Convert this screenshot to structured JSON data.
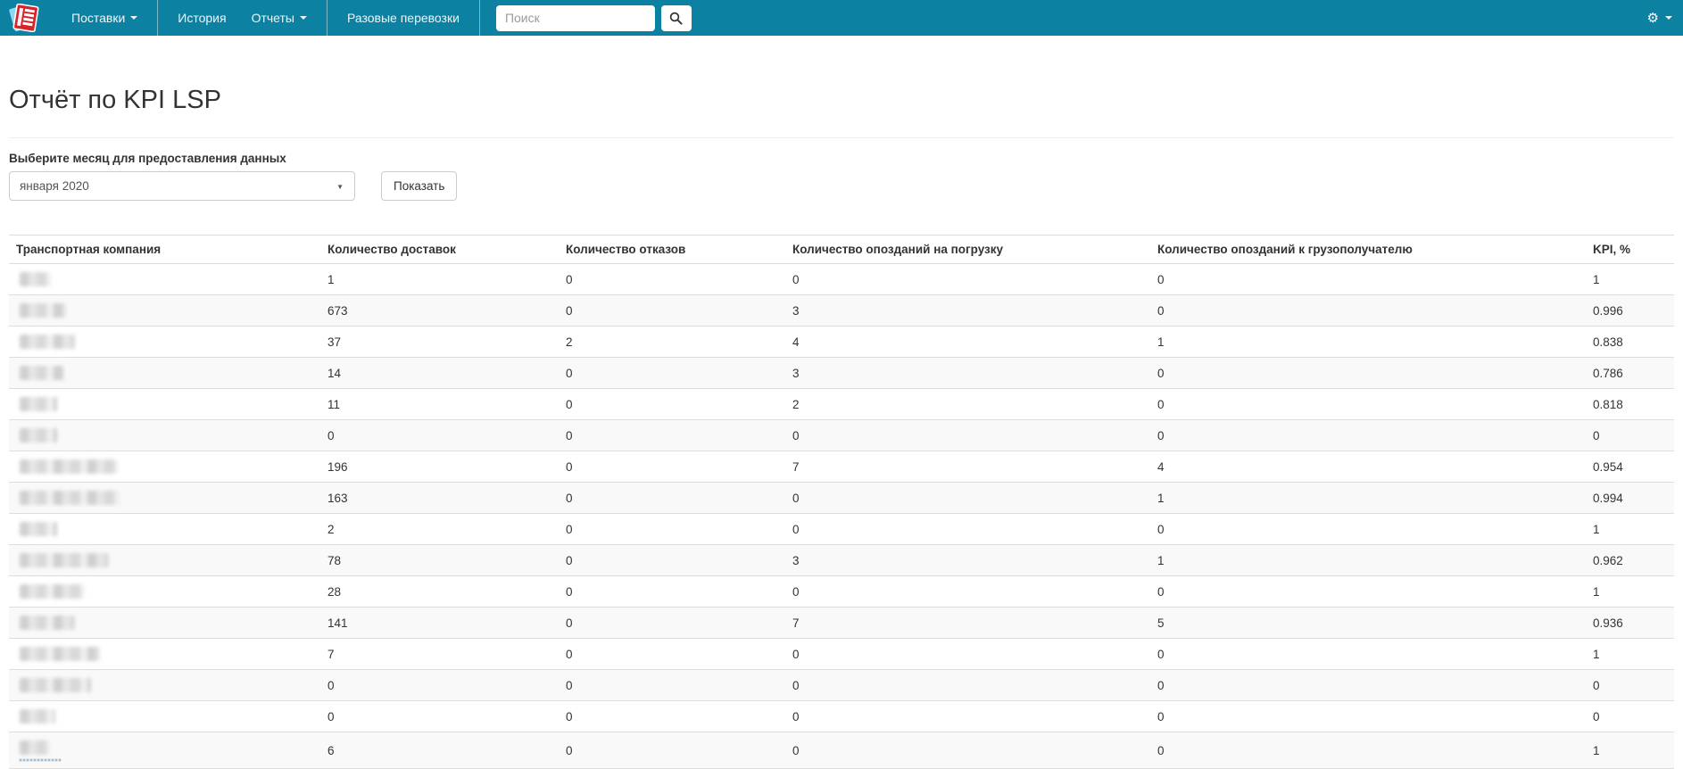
{
  "nav": {
    "items": [
      {
        "label": "Поставки",
        "caret": true
      },
      {
        "label": "История",
        "caret": false
      },
      {
        "label": "Отчеты",
        "caret": true
      },
      {
        "label": "Разовые перевозки",
        "caret": false
      }
    ],
    "search": {
      "placeholder": "Поиск"
    },
    "icons": {
      "gear": "⚙",
      "search": "magnifier-icon",
      "brand": "red-document-stack"
    },
    "colors": {
      "bar": "#0d81a2",
      "brand_red": "#d8232a",
      "brand_cyan": "#8ed9ec"
    }
  },
  "page": {
    "title": "Отчёт по KPI LSP",
    "month_label": "Выберите месяц для предоставления данных",
    "month_selected": "января 2020",
    "show_button": "Показать"
  },
  "table": {
    "columns": [
      "Транспортная компания",
      "Количество доставок",
      "Количество отказов",
      "Количество опозданий на погрузку",
      "Количество опозданий к грузополучателю",
      "KPI, %"
    ],
    "company_redacted": true,
    "rows": [
      {
        "company_blur_width": 35,
        "deliveries": "1",
        "refusals": "0",
        "late_loading": "0",
        "late_consignee": "0",
        "kpi": "1"
      },
      {
        "company_blur_width": 52,
        "deliveries": "673",
        "refusals": "0",
        "late_loading": "3",
        "late_consignee": "0",
        "kpi": "0.996"
      },
      {
        "company_blur_width": 62,
        "deliveries": "37",
        "refusals": "2",
        "late_loading": "4",
        "late_consignee": "1",
        "kpi": "0.838"
      },
      {
        "company_blur_width": 50,
        "deliveries": "14",
        "refusals": "0",
        "late_loading": "3",
        "late_consignee": "0",
        "kpi": "0.786"
      },
      {
        "company_blur_width": 42,
        "deliveries": "11",
        "refusals": "0",
        "late_loading": "2",
        "late_consignee": "0",
        "kpi": "0.818"
      },
      {
        "company_blur_width": 42,
        "deliveries": "0",
        "refusals": "0",
        "late_loading": "0",
        "late_consignee": "0",
        "kpi": "0"
      },
      {
        "company_blur_width": 110,
        "deliveries": "196",
        "refusals": "0",
        "late_loading": "7",
        "late_consignee": "4",
        "kpi": "0.954"
      },
      {
        "company_blur_width": 112,
        "deliveries": "163",
        "refusals": "0",
        "late_loading": "0",
        "late_consignee": "1",
        "kpi": "0.994"
      },
      {
        "company_blur_width": 42,
        "deliveries": "2",
        "refusals": "0",
        "late_loading": "0",
        "late_consignee": "0",
        "kpi": "1"
      },
      {
        "company_blur_width": 100,
        "deliveries": "78",
        "refusals": "0",
        "late_loading": "3",
        "late_consignee": "1",
        "kpi": "0.962"
      },
      {
        "company_blur_width": 72,
        "deliveries": "28",
        "refusals": "0",
        "late_loading": "0",
        "late_consignee": "0",
        "kpi": "1"
      },
      {
        "company_blur_width": 62,
        "deliveries": "141",
        "refusals": "0",
        "late_loading": "7",
        "late_consignee": "5",
        "kpi": "0.936"
      },
      {
        "company_blur_width": 90,
        "deliveries": "7",
        "refusals": "0",
        "late_loading": "0",
        "late_consignee": "0",
        "kpi": "1"
      },
      {
        "company_blur_width": 80,
        "deliveries": "0",
        "refusals": "0",
        "late_loading": "0",
        "late_consignee": "0",
        "kpi": "0"
      },
      {
        "company_blur_width": 40,
        "deliveries": "0",
        "refusals": "0",
        "late_loading": "0",
        "late_consignee": "0",
        "kpi": "0"
      },
      {
        "company_blur_width": 34,
        "deliveries": "6",
        "refusals": "0",
        "late_loading": "0",
        "late_consignee": "0",
        "kpi": "1",
        "link_artifact": true
      }
    ]
  }
}
